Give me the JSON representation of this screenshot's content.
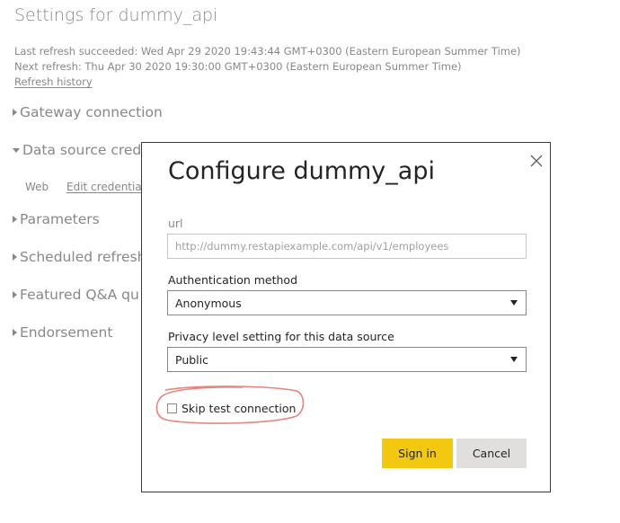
{
  "background": {
    "title": "Settings for dummy_api",
    "last_refresh": "Last refresh succeeded: Wed Apr 29 2020 19:43:44 GMT+0300 (Eastern European Summer Time)",
    "next_refresh": "Next refresh: Thu Apr 30 2020 19:30:00 GMT+0300 (Eastern European Summer Time)",
    "refresh_history_link": "Refresh history",
    "sections": {
      "gateway": "Gateway connection",
      "data_source": "Data source crede",
      "parameters": "Parameters",
      "scheduled": "Scheduled refresh",
      "featured": "Featured Q&A qu",
      "endorsement": "Endorsement"
    },
    "data_source_row": {
      "type": "Web",
      "edit_link": "Edit credentials"
    }
  },
  "dialog": {
    "title": "Configure dummy_api",
    "url_label": "url",
    "url_value": "http://dummy.restapiexample.com/api/v1/employees",
    "auth_label": "Authentication method",
    "auth_value": "Anonymous",
    "privacy_label": "Privacy level setting for this data source",
    "privacy_value": "Public",
    "skip_test_label": "Skip test connection",
    "sign_in_label": "Sign in",
    "cancel_label": "Cancel"
  },
  "colors": {
    "accent": "#f2c811",
    "annotation": "#e8847e",
    "muted_text": "#8a8886"
  },
  "icons": {
    "close": "close-icon",
    "dropdown": "chevron-down-icon"
  }
}
